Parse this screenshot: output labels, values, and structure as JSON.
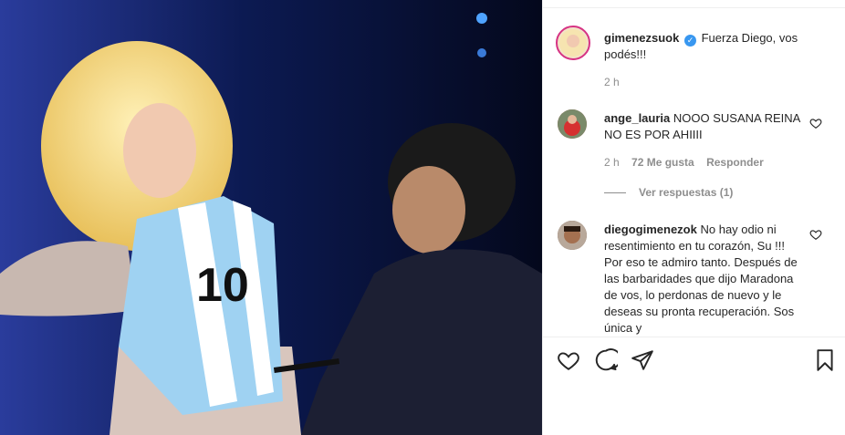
{
  "post": {
    "author": "gimenezsuok",
    "caption": "Fuerza Diego, vos podés!!!",
    "time": "2 h"
  },
  "comments": [
    {
      "user": "ange_lauria",
      "text": "NOOO SUSANA REINA NO ES POR AHIIII",
      "time": "2 h",
      "likes": "72 Me gusta",
      "reply_label": "Responder",
      "view_replies": "Ver respuestas (1)"
    },
    {
      "user": "diegogimenezok",
      "text": "No hay odio ni resentimiento en tu corazón, Su !!! Por eso te admiro tanto. Después de las barbaridades que dijo Maradona de vos, lo perdonas de nuevo y le deseas su pronta recuperación. Sos única y"
    }
  ],
  "photo": {
    "jersey_number": "10"
  },
  "icons": {
    "like": "heart-icon",
    "comment": "comment-icon",
    "share": "share-icon",
    "save": "bookmark-icon",
    "verified": "verified-badge-icon"
  },
  "colors": {
    "verified": "#3897f0",
    "secondary_text": "#8e8e8e",
    "divider": "#efefef"
  }
}
